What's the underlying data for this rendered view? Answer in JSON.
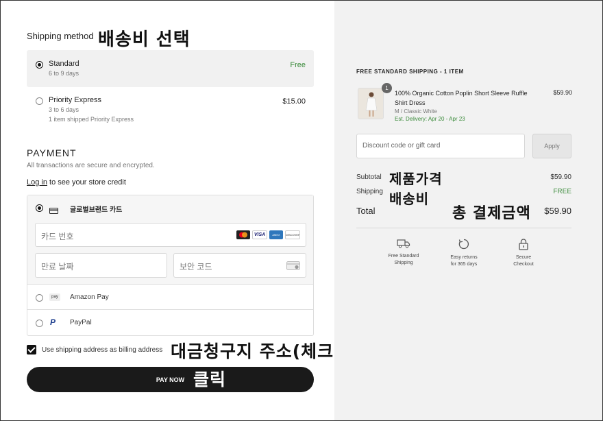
{
  "shipping": {
    "title": "Shipping method",
    "annotation": "배송비 선택",
    "options": [
      {
        "name": "Standard",
        "sub": "6 to 9 days",
        "price": "Free",
        "selected": true
      },
      {
        "name": "Priority Express",
        "sub": "3 to 6 days",
        "sub2": "1 item shipped Priority Express",
        "price": "$15.00",
        "selected": false
      }
    ]
  },
  "payment": {
    "title": "PAYMENT",
    "subtitle": "All transactions are secure and encrypted.",
    "login_link": "Log in",
    "login_rest": " to see your store credit",
    "card_label": "글로벌브랜드 카드",
    "card_number_placeholder": "카드 번호",
    "expiry_placeholder": "만료 날짜",
    "cvv_placeholder": "보안 코드",
    "card_brands": [
      "VISA",
      "AMEX",
      "DISCOVER"
    ],
    "amazon_pay": "Amazon Pay",
    "amazon_icon_text": "pay",
    "paypal": "PayPal",
    "paypal_icon_text": "P",
    "billing_checkbox": "Use shipping address as billing address",
    "billing_checked": true,
    "billing_annotation": "대금청구지 주소(체크o)",
    "pay_button": "PAY NOW",
    "pay_annotation": "클릭"
  },
  "summary": {
    "header": "FREE STANDARD SHIPPING - 1 ITEM",
    "item": {
      "qty": "1",
      "name": "100% Organic Cotton Poplin Short Sleeve Ruffle Shirt Dress",
      "variant": "M / Classic White",
      "delivery": "Est. Delivery: Apr 20 - Apr 23",
      "price": "$59.90"
    },
    "discount_placeholder": "Discount code or gift card",
    "apply_label": "Apply",
    "subtotal_label": "Subtotal",
    "subtotal_value": "$59.90",
    "subtotal_annotation": "제품가격",
    "shipping_label": "Shipping",
    "shipping_value": "FREE",
    "shipping_annotation": "배송비",
    "total_label": "Total",
    "total_value": "$59.90",
    "total_annotation": "총 결제금액",
    "features": [
      {
        "line1": "Free Standard",
        "line2": "Shipping",
        "icon": "truck-icon"
      },
      {
        "line1": "Easy returns",
        "line2": "for 365 days",
        "icon": "return-icon"
      },
      {
        "line1": "Secure",
        "line2": "Checkout",
        "icon": "lock-icon"
      }
    ]
  },
  "colors": {
    "accent_green": "#3a8a3a",
    "button_dark": "#1a1a1a",
    "panel_gray": "#f2f2f2"
  }
}
